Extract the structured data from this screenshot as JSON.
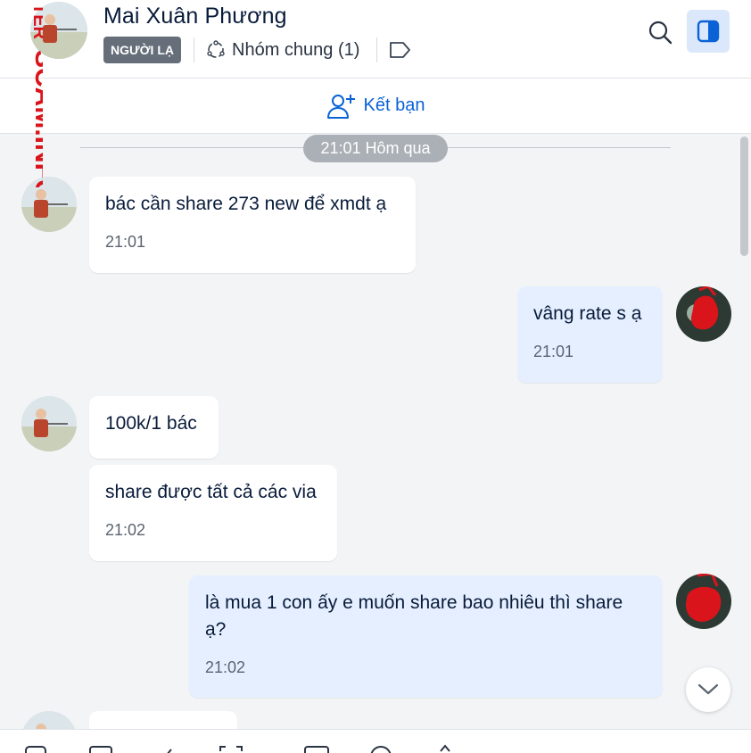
{
  "header": {
    "contact_name": "Mai Xuân Phương",
    "badge": "NGƯỜI LẠ",
    "common_group": "Nhóm chung (1)",
    "watermark": "TER SCAM.INFO"
  },
  "friend_bar": {
    "label": "Kết bạn"
  },
  "chat": {
    "time_divider": "21:01 Hôm qua",
    "messages": [
      {
        "text": "bác cần share 273 new để xmdt ạ",
        "time": "21:01"
      },
      {
        "text": "vâng rate s ạ",
        "time": "21:01"
      },
      {
        "text": "100k/1 bác",
        "time": ""
      },
      {
        "text": "share được tất cả các via",
        "time": "21:02"
      },
      {
        "text": "là mua 1 con ấy e muốn share bao nhiêu thì share ạ?",
        "time": "21:02"
      }
    ]
  },
  "colors": {
    "accent": "#0a62d6",
    "incoming_bubble": "#ffffff",
    "outgoing_bubble": "#e5efff",
    "badge": "#666e7a",
    "watermark": "#d9141b"
  },
  "icons": [
    "search-icon",
    "panel-toggle-icon",
    "group-icon",
    "tag-icon",
    "add-user-icon",
    "chevron-down-icon"
  ]
}
